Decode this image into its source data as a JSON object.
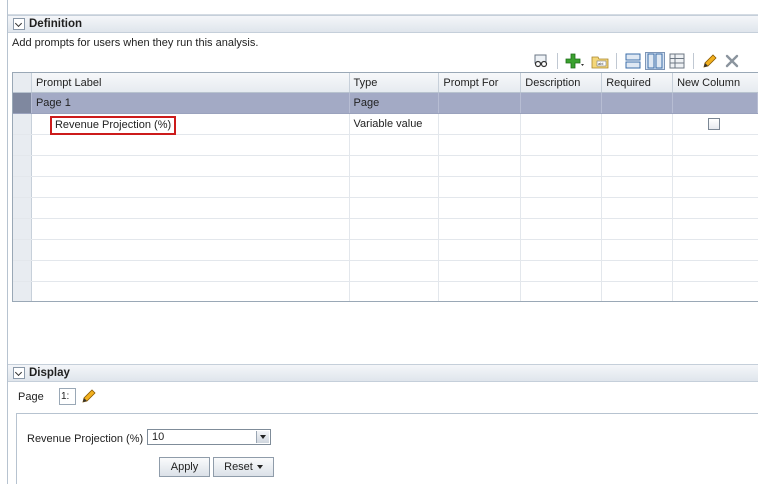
{
  "definition": {
    "title": "Definition",
    "instruction": "Add prompts for users when they run this analysis.",
    "toolbar": [
      {
        "name": "preview-icon"
      },
      {
        "name": "add-icon"
      },
      {
        "name": "folder-icon"
      },
      {
        "name": "row-layout-icon"
      },
      {
        "name": "column-layout-icon"
      },
      {
        "name": "grid-layout-icon"
      },
      {
        "name": "edit-icon"
      },
      {
        "name": "delete-icon"
      }
    ],
    "columns": [
      "Prompt Label",
      "Type",
      "Prompt For",
      "Description",
      "Required",
      "New Column"
    ],
    "rows": [
      {
        "label": "Page 1",
        "type": "Page",
        "selected": true
      },
      {
        "label": "Revenue Projection (%)",
        "type": "Variable value",
        "new_column": false,
        "highlighted": true
      }
    ]
  },
  "display": {
    "title": "Display",
    "page_label": "Page",
    "page_value": "1:",
    "prompt_label": "Revenue Projection (%)",
    "prompt_value": "10",
    "apply_label": "Apply",
    "reset_label": "Reset"
  }
}
